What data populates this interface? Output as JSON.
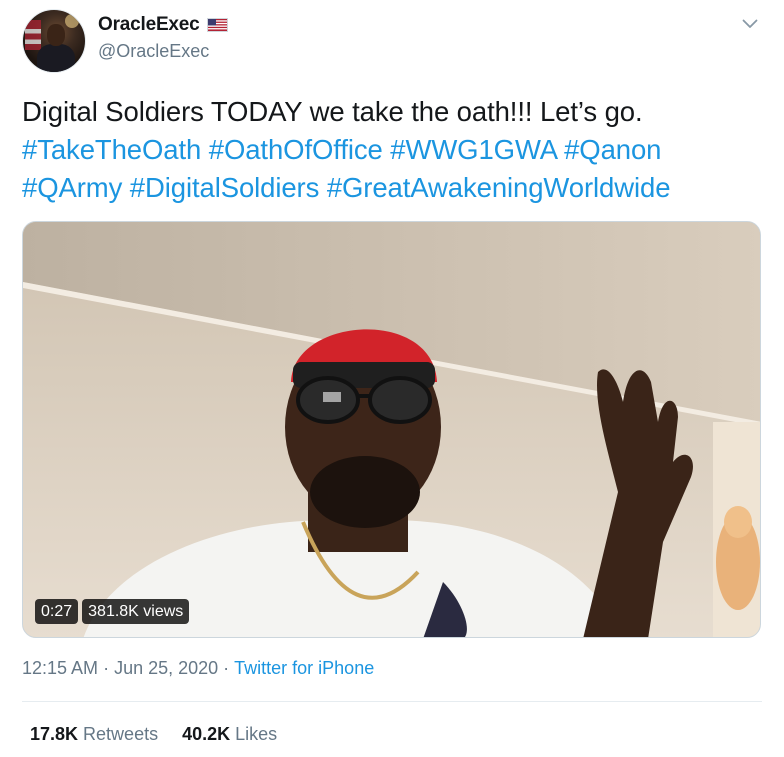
{
  "author": {
    "display_name": "OracleExec",
    "handle": "@OracleExec",
    "flag_icon": "us-flag-icon"
  },
  "tweet": {
    "lines": [
      [
        {
          "text": "Digital Soldiers TODAY we take the oath!!! Let’s go.",
          "hashtag": false
        }
      ],
      [
        {
          "text": "#TakeTheOath",
          "hashtag": true
        },
        {
          "text": " ",
          "hashtag": false
        },
        {
          "text": "#OathOfOffice",
          "hashtag": true
        },
        {
          "text": " ",
          "hashtag": false
        },
        {
          "text": "#WWG1GWA",
          "hashtag": true
        },
        {
          "text": " ",
          "hashtag": false
        },
        {
          "text": "#Qanon",
          "hashtag": true
        }
      ],
      [
        {
          "text": "#QArmy",
          "hashtag": true
        },
        {
          "text": " ",
          "hashtag": false
        },
        {
          "text": "#DigitalSoldiers",
          "hashtag": true
        },
        {
          "text": " ",
          "hashtag": false
        },
        {
          "text": "#GreatAwakeningWorldwide",
          "hashtag": true
        }
      ]
    ]
  },
  "video": {
    "duration": "0:27",
    "views": "381.8K views"
  },
  "meta": {
    "time": "12:15 AM",
    "separator1": "·",
    "date": "Jun 25, 2020",
    "separator2": "·",
    "source": "Twitter for iPhone"
  },
  "stats": {
    "retweets_count": "17.8K",
    "retweets_label": "Retweets",
    "likes_count": "40.2K",
    "likes_label": "Likes"
  },
  "colors": {
    "link": "#1b95e0",
    "secondary_text": "#657786",
    "primary_text": "#14171a"
  },
  "icons": {
    "caret": "chevron-down-icon"
  }
}
